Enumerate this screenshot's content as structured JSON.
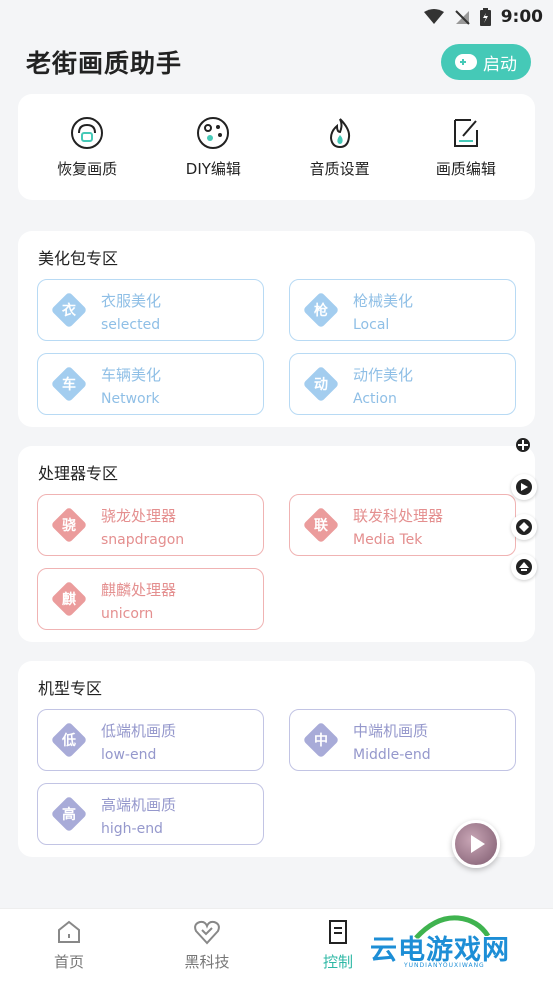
{
  "status_bar": {
    "time": "9:00"
  },
  "header": {
    "title": "老街画质助手",
    "start_label": "启动"
  },
  "quick_actions": [
    {
      "label": "恢复画质",
      "icon": "restore-icon"
    },
    {
      "label": "DIY编辑",
      "icon": "palette-icon"
    },
    {
      "label": "音质设置",
      "icon": "flame-icon"
    },
    {
      "label": "画质编辑",
      "icon": "edit-icon"
    }
  ],
  "beautify": {
    "title": "美化包专区",
    "items": [
      {
        "badge": "衣",
        "title": "衣服美化",
        "sub": "selected"
      },
      {
        "badge": "枪",
        "title": "枪械美化",
        "sub": "Local"
      },
      {
        "badge": "车",
        "title": "车辆美化",
        "sub": "Network"
      },
      {
        "badge": "动",
        "title": "动作美化",
        "sub": "Action"
      }
    ]
  },
  "processor": {
    "title": "处理器专区",
    "items": [
      {
        "badge": "骁",
        "title": "骁龙处理器",
        "sub": "snapdragon"
      },
      {
        "badge": "联",
        "title": "联发科处理器",
        "sub": "Media Tek"
      },
      {
        "badge": "麒",
        "title": "麒麟处理器",
        "sub": "unicorn"
      }
    ]
  },
  "model": {
    "title": "机型专区",
    "items": [
      {
        "badge": "低",
        "title": "低端机画质",
        "sub": "low-end"
      },
      {
        "badge": "中",
        "title": "中端机画质",
        "sub": "Middle-end"
      },
      {
        "badge": "高",
        "title": "高端机画质",
        "sub": "high-end"
      }
    ]
  },
  "bottom_nav": [
    {
      "label": "首页",
      "icon": "home-icon"
    },
    {
      "label": "黑科技",
      "icon": "heart-icon"
    },
    {
      "label": "控制",
      "icon": "document-icon",
      "active": true
    }
  ],
  "watermark": {
    "text": "云电游戏网",
    "sub": "YUNDIANYOUXIWANG"
  },
  "colors": {
    "accent": "#45c9b7",
    "blue": "#8fbfe6",
    "red": "#e48f8f",
    "purple": "#9598cc"
  }
}
